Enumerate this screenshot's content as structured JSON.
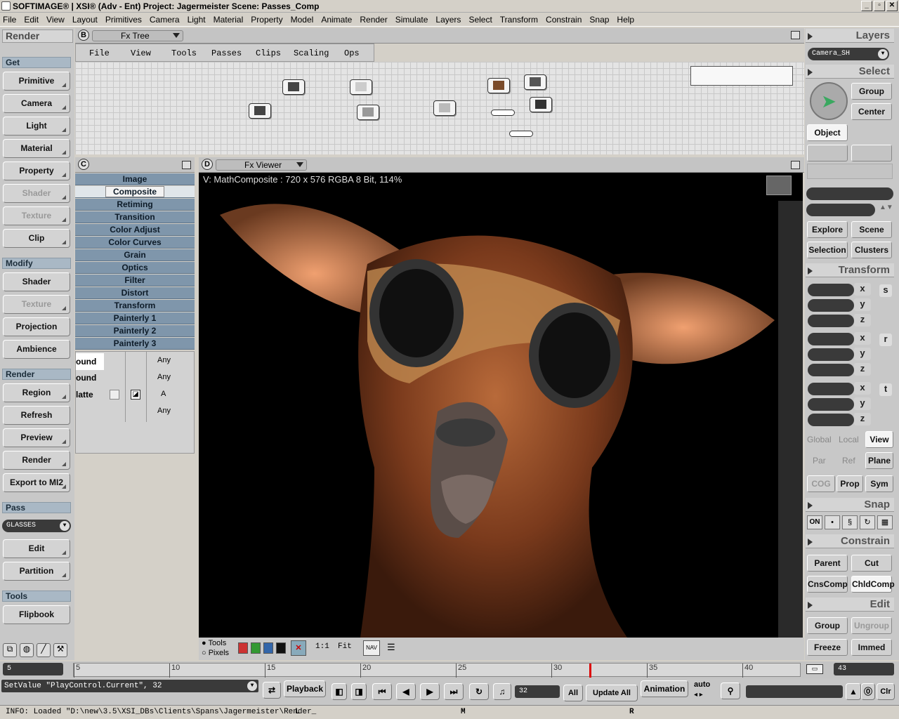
{
  "title": "SOFTIMAGE® | XSI® (Adv - Ent) Project: Jagermeister    Scene: Passes_Comp",
  "window_buttons": [
    "_",
    "▫",
    "✕"
  ],
  "menu": [
    "File",
    "Edit",
    "View",
    "Layout",
    "Primitives",
    "Camera",
    "Light",
    "Material",
    "Property",
    "Model",
    "Animate",
    "Render",
    "Simulate",
    "Layers",
    "Select",
    "Transform",
    "Constrain",
    "Snap",
    "Help"
  ],
  "left": {
    "title": "Render",
    "sections": {
      "get": "Get",
      "modify": "Modify",
      "render": "Render",
      "pass": "Pass",
      "tools": "Tools"
    },
    "get_buttons": [
      "Primitive",
      "Camera",
      "Light",
      "Material",
      "Property",
      "Shader",
      "Texture",
      "Clip"
    ],
    "modify_buttons": [
      "Shader",
      "Texture",
      "Projection",
      "Ambience"
    ],
    "render_buttons": [
      "Region",
      "Refresh",
      "Preview",
      "Render",
      "Export to MI2"
    ],
    "pass_combo": "GLASSES",
    "pass_buttons": [
      "Edit",
      "Partition"
    ],
    "tools_buttons": [
      "Flipbook"
    ]
  },
  "fxtree": {
    "badge": "B",
    "label": "Fx Tree",
    "submenu": [
      "File",
      "View",
      "Tools",
      "Passes",
      "Clips",
      "Scaling",
      "Ops"
    ]
  },
  "panel_c": {
    "badge": "C",
    "categories": [
      "Image",
      "Composite",
      "Retiming",
      "Transition",
      "Color Adjust",
      "Color Curves",
      "Grain",
      "Optics",
      "Filter",
      "Distort",
      "Transform",
      "Painterly 1",
      "Painterly 2",
      "Painterly 3"
    ],
    "selected": "Composite",
    "rows": [
      {
        "name": "ound",
        "value": "Any"
      },
      {
        "name": "ound",
        "value": "Any"
      },
      {
        "name": "latte",
        "value": "A"
      },
      {
        "name": "",
        "value": "Any"
      }
    ]
  },
  "viewer": {
    "badge": "D",
    "label": "Fx Viewer",
    "info": "V: MathComposite : 720 x 576 RGBA 8 Bit, 114%",
    "bottom": {
      "tools": "Tools",
      "pixels": "Pixels",
      "one_to_one": "1:1",
      "fit": "Fit",
      "nav": "NAV"
    }
  },
  "right": {
    "layers_title": "Layers",
    "layers_combo": "Camera_SH",
    "select_title": "Select",
    "select_buttons": [
      "Group",
      "Center",
      "Object"
    ],
    "explore_buttons": [
      "Explore",
      "Scene",
      "Selection",
      "Clusters"
    ],
    "transform_title": "Transform",
    "axes": [
      "x",
      "y",
      "z"
    ],
    "transform_side": [
      "s",
      "r",
      "t"
    ],
    "space_row1": [
      "Global",
      "Local",
      "View"
    ],
    "space_row2": [
      "Par",
      "Ref",
      "Plane"
    ],
    "space_row3": [
      "COG",
      "Prop",
      "Sym"
    ],
    "snap_title": "Snap",
    "snap_on": "ON",
    "constrain_title": "Constrain",
    "constrain_buttons": [
      "Parent",
      "Cut",
      "CnsComp",
      "ChldComp"
    ],
    "edit_title": "Edit",
    "edit_buttons": [
      "Group",
      "Ungroup",
      "Freeze",
      "Immed"
    ]
  },
  "timeline": {
    "start": "5",
    "end": "43",
    "ticks": [
      "5",
      "10",
      "15",
      "20",
      "25",
      "30",
      "35",
      "40"
    ],
    "current": 32
  },
  "controls": {
    "command": "SetValue \"PlayControl.Current\", 32",
    "playback": "Playback",
    "frame": "32",
    "all": "All",
    "update_all": "Update All",
    "animation": "Animation",
    "auto": "auto",
    "clr": "Clr"
  },
  "status": {
    "info": "INFO: Loaded \"D:\\new\\3.5\\XSI_DBs\\Clients\\Spans\\Jagermeister\\Render_",
    "mouse": [
      "L",
      "M",
      "R"
    ]
  },
  "colors": {
    "accent": "#7f96ab",
    "section": "#a9b8c5",
    "panel": "#c8c8c8"
  }
}
